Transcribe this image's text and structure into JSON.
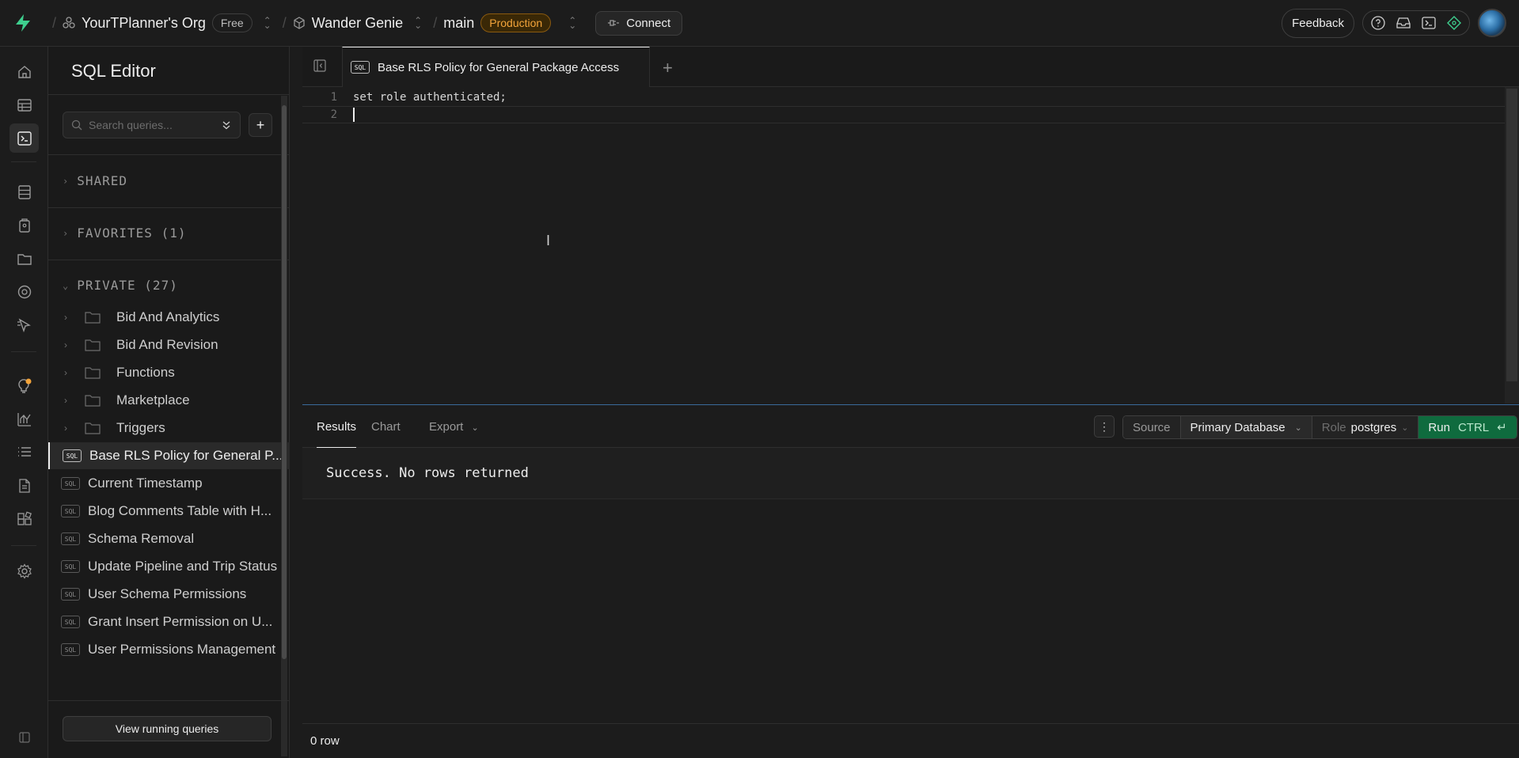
{
  "topbar": {
    "org": "YourTPlanner's Org",
    "plan": "Free",
    "project": "Wander Genie",
    "branch": "main",
    "env": "Production",
    "connect": "Connect",
    "feedback": "Feedback"
  },
  "sidebar": {
    "title": "SQL Editor",
    "search_placeholder": "Search queries...",
    "shared": "SHARED",
    "favorites": "FAVORITES (1)",
    "private": "PRIVATE (27)",
    "folders": [
      "Bid And Analytics",
      "Bid And Revision",
      "Functions",
      "Marketplace",
      "Triggers"
    ],
    "files": [
      "Base RLS Policy for General P...",
      "Current Timestamp",
      "Blog Comments Table with H...",
      "Schema Removal",
      "Update Pipeline and Trip Status",
      "User Schema Permissions",
      "Grant Insert Permission on U...",
      "User Permissions Management"
    ],
    "sql_tag": "SQL",
    "view_running": "View running queries"
  },
  "editor": {
    "tab_title": "Base RLS Policy for General Package Access",
    "lines": [
      "set role authenticated;",
      ""
    ],
    "line_numbers": [
      "1",
      "2"
    ]
  },
  "results": {
    "tabs": [
      "Results",
      "Chart",
      "Export"
    ],
    "source_label": "Source",
    "source_value": "Primary Database",
    "role_label": "Role",
    "role_value": "postgres",
    "run": "Run",
    "run_shortcut": "CTRL",
    "message": "Success. No rows returned",
    "row_count": "0 row"
  },
  "colors": {
    "accent": "#3ecf8e",
    "run": "#0f6b3e",
    "production": "#f3a43a"
  }
}
